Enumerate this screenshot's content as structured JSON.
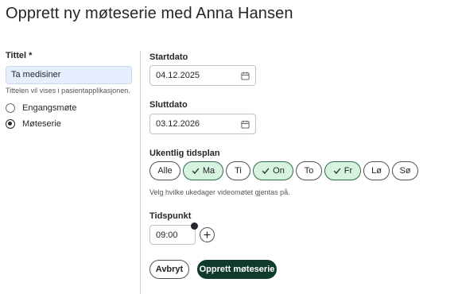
{
  "page": {
    "title": "Opprett ny møteserie med Anna Hansen"
  },
  "title_field": {
    "label": "Tittel *",
    "value": "Ta medisiner",
    "helper": "Tittelen vil vises i pasientapplikasjonen."
  },
  "meeting_type": {
    "options": [
      {
        "label": "Engangsmøte",
        "checked": false
      },
      {
        "label": "Møteserie",
        "checked": true
      }
    ]
  },
  "start_date": {
    "label": "Startdato",
    "value": "04.12.2025",
    "icon": "calendar-icon"
  },
  "end_date": {
    "label": "Sluttdato",
    "value": "03.12.2026",
    "icon": "calendar-icon"
  },
  "weekly_schedule": {
    "label": "Ukentlig tidsplan",
    "helper": "Velg hvilke ukedager videomøtet gjentas på.",
    "days": [
      {
        "label": "Alle",
        "selected": false
      },
      {
        "label": "Ma",
        "selected": true
      },
      {
        "label": "Ti",
        "selected": false
      },
      {
        "label": "On",
        "selected": true
      },
      {
        "label": "To",
        "selected": false
      },
      {
        "label": "Fr",
        "selected": true
      },
      {
        "label": "Lø",
        "selected": false
      },
      {
        "label": "Sø",
        "selected": false
      }
    ]
  },
  "time": {
    "label": "Tidspunkt",
    "value": "09:00",
    "add_icon": "plus-icon"
  },
  "actions": {
    "cancel_label": "Avbryt",
    "create_label": "Opprett møteserie"
  },
  "colors": {
    "primary_button": "#0f3b2e",
    "selected_day": "#d6f3df",
    "title_input_bg": "#e6effd"
  }
}
